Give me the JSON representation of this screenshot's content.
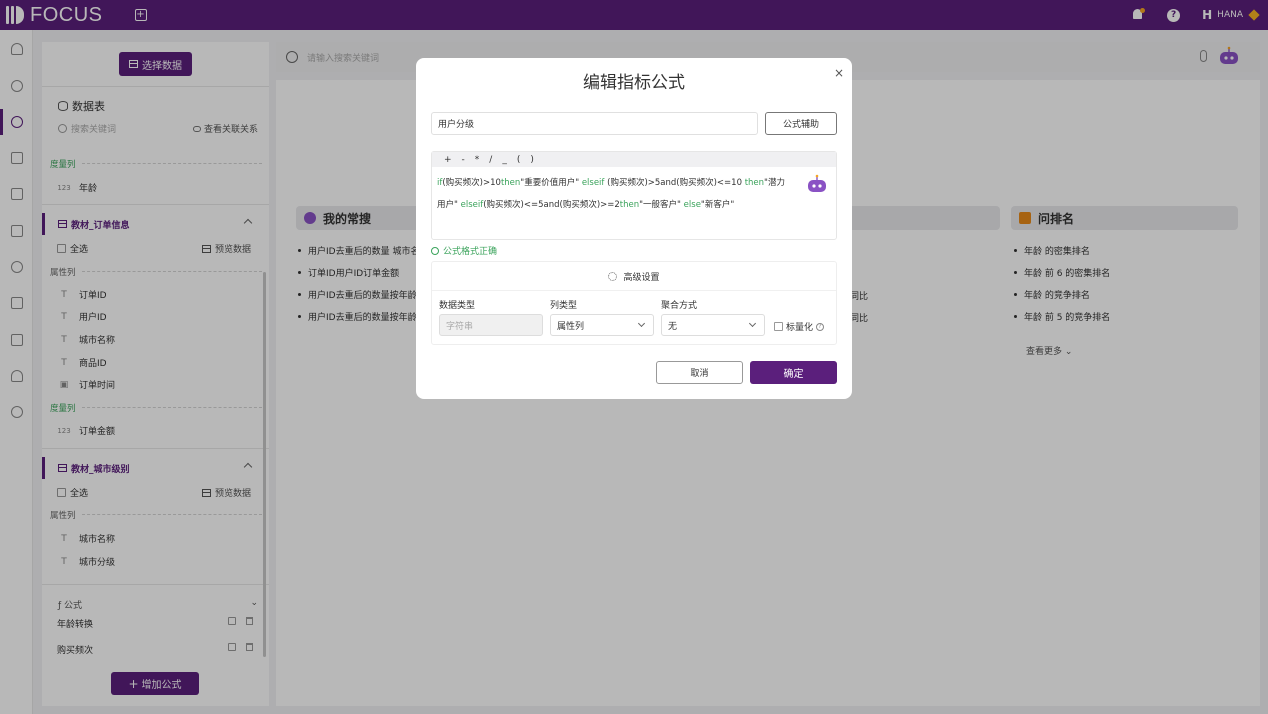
{
  "topbar": {
    "brand": "FOCUS",
    "new_tab": "+",
    "user_initial": "H",
    "user_name": "HANA",
    "help": "?"
  },
  "panel": {
    "pick_data": "选择数据",
    "section_title": "数据表",
    "search_placeholder": "搜索关键词",
    "view_relations": "查看关联关系",
    "measure_label": "度量列",
    "attr_label": "属性列",
    "cut_item": "年龄",
    "tables": [
      {
        "name": "教材_订单信息",
        "select_all": "全选",
        "preview": "预览数据",
        "attributes": [
          "订单ID",
          "用户ID",
          "城市名称",
          "商品ID",
          "订单时间"
        ],
        "measures": [
          "订单金额"
        ]
      },
      {
        "name": "教材_城市级别",
        "select_all": "全选",
        "preview": "预览数据",
        "attributes": [
          "城市名称",
          "城市分级"
        ]
      }
    ],
    "formula_title": "公式",
    "formulas": [
      "年龄转换",
      "购买频次"
    ],
    "add_formula": "增加公式"
  },
  "main": {
    "search_placeholder": "请输入搜索关键词",
    "my_common": "我的常搜",
    "common_items": [
      "用户ID去重后的数量 城市名",
      "订单ID用户ID订单金额",
      "用户ID去重后的数量按年龄",
      "用户ID去重后的数量按年龄"
    ],
    "mid_items": [
      "同比",
      "同比"
    ],
    "rank_title": "问排名",
    "rank_items": [
      "年龄 的密集排名",
      "年龄 前 6 的密集排名",
      "年龄 的竞争排名",
      "年龄 前 5 的竞争排名"
    ],
    "more": "查看更多"
  },
  "dialog": {
    "title": "编辑指标公式",
    "close": "×",
    "name_value": "用户分级",
    "assist": "公式辅助",
    "ops": [
      "+",
      "-",
      "*",
      "/",
      "_",
      "(",
      ")"
    ],
    "code": {
      "t1": "if",
      "t2": "(购买频次)>10",
      "t3": "then",
      "t4": "\"重要价值用户\" ",
      "t5": "elseif",
      "t6": " (购买频次)>5and(购买频次)<=10 ",
      "t7": "then",
      "t8": "\"潜力",
      "t9": "用户\" ",
      "t10": "elseif",
      "t11": "(购买频次)<=5and(购买频次)>=2",
      "t12": "then",
      "t13": "\"一般客户\" ",
      "t14": "else",
      "t15": "\"新客户\""
    },
    "valid_msg": "公式格式正确",
    "advanced": "高级设置",
    "data_type_label": "数据类型",
    "data_type_value": "字符串",
    "col_type_label": "列类型",
    "col_type_value": "属性列",
    "agg_label": "聚合方式",
    "agg_value": "无",
    "metric_label": "标量化",
    "cancel": "取消",
    "ok": "确定"
  },
  "colors": {
    "brand": "#5b1f7c",
    "green": "#3aa35b",
    "rank_icon": "#e88a1a",
    "common_icon": "#8a52c4"
  }
}
